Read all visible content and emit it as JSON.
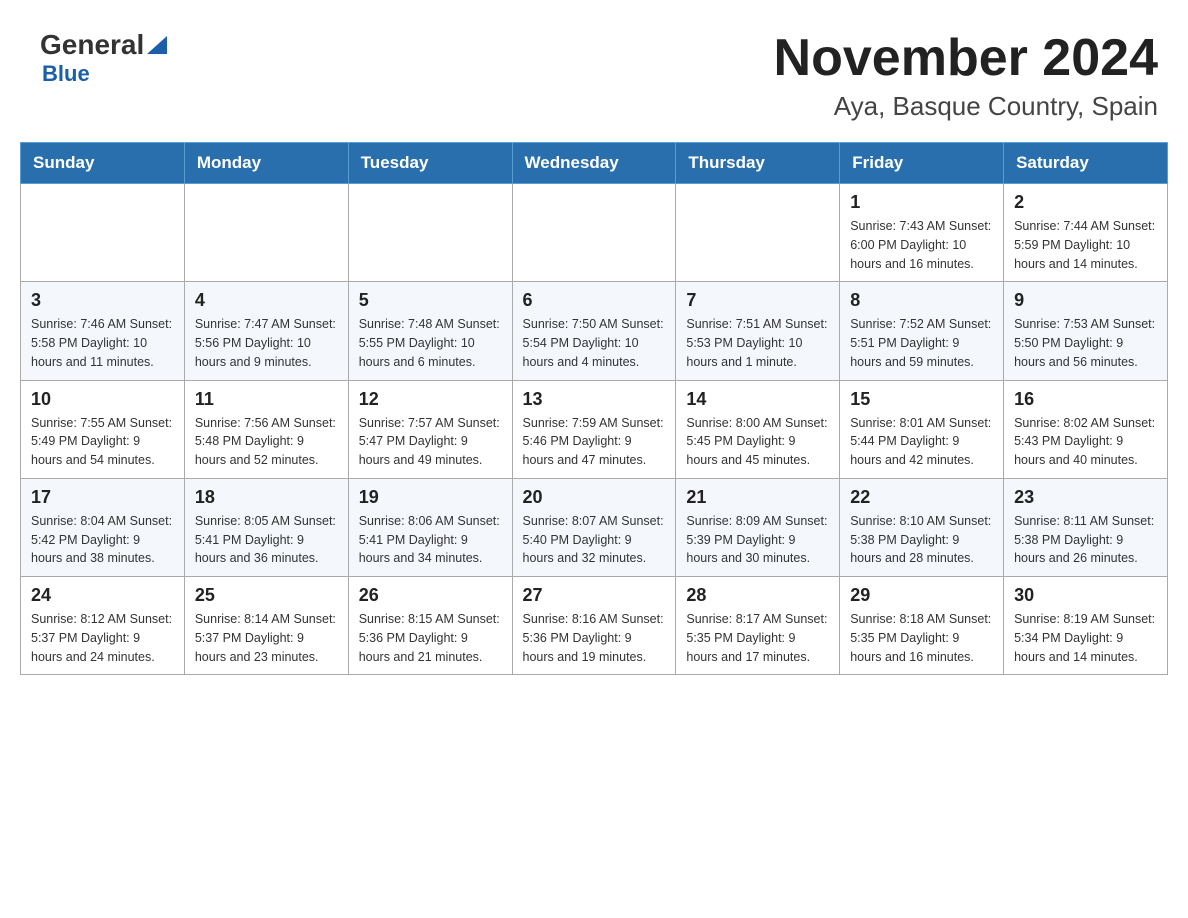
{
  "header": {
    "logo_main": "General",
    "logo_sub": "Blue",
    "title": "November 2024",
    "subtitle": "Aya, Basque Country, Spain"
  },
  "weekdays": [
    "Sunday",
    "Monday",
    "Tuesday",
    "Wednesday",
    "Thursday",
    "Friday",
    "Saturday"
  ],
  "weeks": [
    [
      {
        "day": "",
        "info": ""
      },
      {
        "day": "",
        "info": ""
      },
      {
        "day": "",
        "info": ""
      },
      {
        "day": "",
        "info": ""
      },
      {
        "day": "",
        "info": ""
      },
      {
        "day": "1",
        "info": "Sunrise: 7:43 AM\nSunset: 6:00 PM\nDaylight: 10 hours\nand 16 minutes."
      },
      {
        "day": "2",
        "info": "Sunrise: 7:44 AM\nSunset: 5:59 PM\nDaylight: 10 hours\nand 14 minutes."
      }
    ],
    [
      {
        "day": "3",
        "info": "Sunrise: 7:46 AM\nSunset: 5:58 PM\nDaylight: 10 hours\nand 11 minutes."
      },
      {
        "day": "4",
        "info": "Sunrise: 7:47 AM\nSunset: 5:56 PM\nDaylight: 10 hours\nand 9 minutes."
      },
      {
        "day": "5",
        "info": "Sunrise: 7:48 AM\nSunset: 5:55 PM\nDaylight: 10 hours\nand 6 minutes."
      },
      {
        "day": "6",
        "info": "Sunrise: 7:50 AM\nSunset: 5:54 PM\nDaylight: 10 hours\nand 4 minutes."
      },
      {
        "day": "7",
        "info": "Sunrise: 7:51 AM\nSunset: 5:53 PM\nDaylight: 10 hours\nand 1 minute."
      },
      {
        "day": "8",
        "info": "Sunrise: 7:52 AM\nSunset: 5:51 PM\nDaylight: 9 hours\nand 59 minutes."
      },
      {
        "day": "9",
        "info": "Sunrise: 7:53 AM\nSunset: 5:50 PM\nDaylight: 9 hours\nand 56 minutes."
      }
    ],
    [
      {
        "day": "10",
        "info": "Sunrise: 7:55 AM\nSunset: 5:49 PM\nDaylight: 9 hours\nand 54 minutes."
      },
      {
        "day": "11",
        "info": "Sunrise: 7:56 AM\nSunset: 5:48 PM\nDaylight: 9 hours\nand 52 minutes."
      },
      {
        "day": "12",
        "info": "Sunrise: 7:57 AM\nSunset: 5:47 PM\nDaylight: 9 hours\nand 49 minutes."
      },
      {
        "day": "13",
        "info": "Sunrise: 7:59 AM\nSunset: 5:46 PM\nDaylight: 9 hours\nand 47 minutes."
      },
      {
        "day": "14",
        "info": "Sunrise: 8:00 AM\nSunset: 5:45 PM\nDaylight: 9 hours\nand 45 minutes."
      },
      {
        "day": "15",
        "info": "Sunrise: 8:01 AM\nSunset: 5:44 PM\nDaylight: 9 hours\nand 42 minutes."
      },
      {
        "day": "16",
        "info": "Sunrise: 8:02 AM\nSunset: 5:43 PM\nDaylight: 9 hours\nand 40 minutes."
      }
    ],
    [
      {
        "day": "17",
        "info": "Sunrise: 8:04 AM\nSunset: 5:42 PM\nDaylight: 9 hours\nand 38 minutes."
      },
      {
        "day": "18",
        "info": "Sunrise: 8:05 AM\nSunset: 5:41 PM\nDaylight: 9 hours\nand 36 minutes."
      },
      {
        "day": "19",
        "info": "Sunrise: 8:06 AM\nSunset: 5:41 PM\nDaylight: 9 hours\nand 34 minutes."
      },
      {
        "day": "20",
        "info": "Sunrise: 8:07 AM\nSunset: 5:40 PM\nDaylight: 9 hours\nand 32 minutes."
      },
      {
        "day": "21",
        "info": "Sunrise: 8:09 AM\nSunset: 5:39 PM\nDaylight: 9 hours\nand 30 minutes."
      },
      {
        "day": "22",
        "info": "Sunrise: 8:10 AM\nSunset: 5:38 PM\nDaylight: 9 hours\nand 28 minutes."
      },
      {
        "day": "23",
        "info": "Sunrise: 8:11 AM\nSunset: 5:38 PM\nDaylight: 9 hours\nand 26 minutes."
      }
    ],
    [
      {
        "day": "24",
        "info": "Sunrise: 8:12 AM\nSunset: 5:37 PM\nDaylight: 9 hours\nand 24 minutes."
      },
      {
        "day": "25",
        "info": "Sunrise: 8:14 AM\nSunset: 5:37 PM\nDaylight: 9 hours\nand 23 minutes."
      },
      {
        "day": "26",
        "info": "Sunrise: 8:15 AM\nSunset: 5:36 PM\nDaylight: 9 hours\nand 21 minutes."
      },
      {
        "day": "27",
        "info": "Sunrise: 8:16 AM\nSunset: 5:36 PM\nDaylight: 9 hours\nand 19 minutes."
      },
      {
        "day": "28",
        "info": "Sunrise: 8:17 AM\nSunset: 5:35 PM\nDaylight: 9 hours\nand 17 minutes."
      },
      {
        "day": "29",
        "info": "Sunrise: 8:18 AM\nSunset: 5:35 PM\nDaylight: 9 hours\nand 16 minutes."
      },
      {
        "day": "30",
        "info": "Sunrise: 8:19 AM\nSunset: 5:34 PM\nDaylight: 9 hours\nand 14 minutes."
      }
    ]
  ]
}
